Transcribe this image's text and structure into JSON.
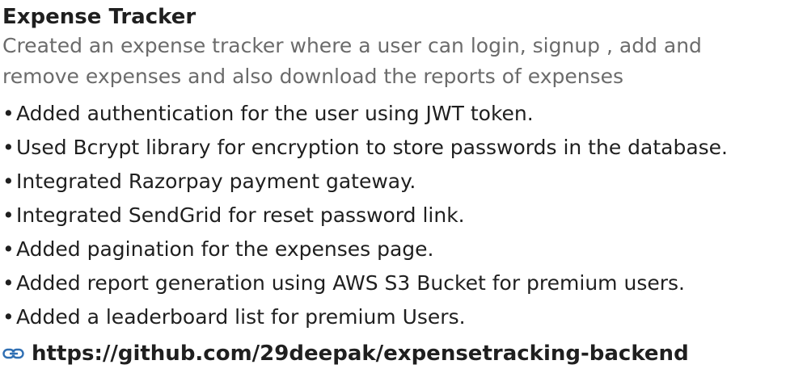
{
  "project": {
    "title": "Expense Tracker",
    "description": "Created an expense tracker where a user can login, signup , add and remove expenses and also download the reports of expenses",
    "bullet_glyph": "•",
    "bullets": [
      "Added authentication for the user using JWT token.",
      "Used Bcrypt library for encryption to store passwords in the database.",
      "Integrated Razorpay payment gateway.",
      "Integrated SendGrid for reset password link.",
      "Added pagination for the expenses page.",
      "Added report generation using AWS S3 Bucket for premium users.",
      "Added a leaderboard list for premium Users."
    ],
    "link": {
      "icon": "link-icon",
      "text": "https://github.com/29deepak/expensetracking-backend"
    }
  },
  "colors": {
    "text": "#1f1f1f",
    "muted": "#6b6b6b",
    "accent": "#2f6fb3"
  }
}
